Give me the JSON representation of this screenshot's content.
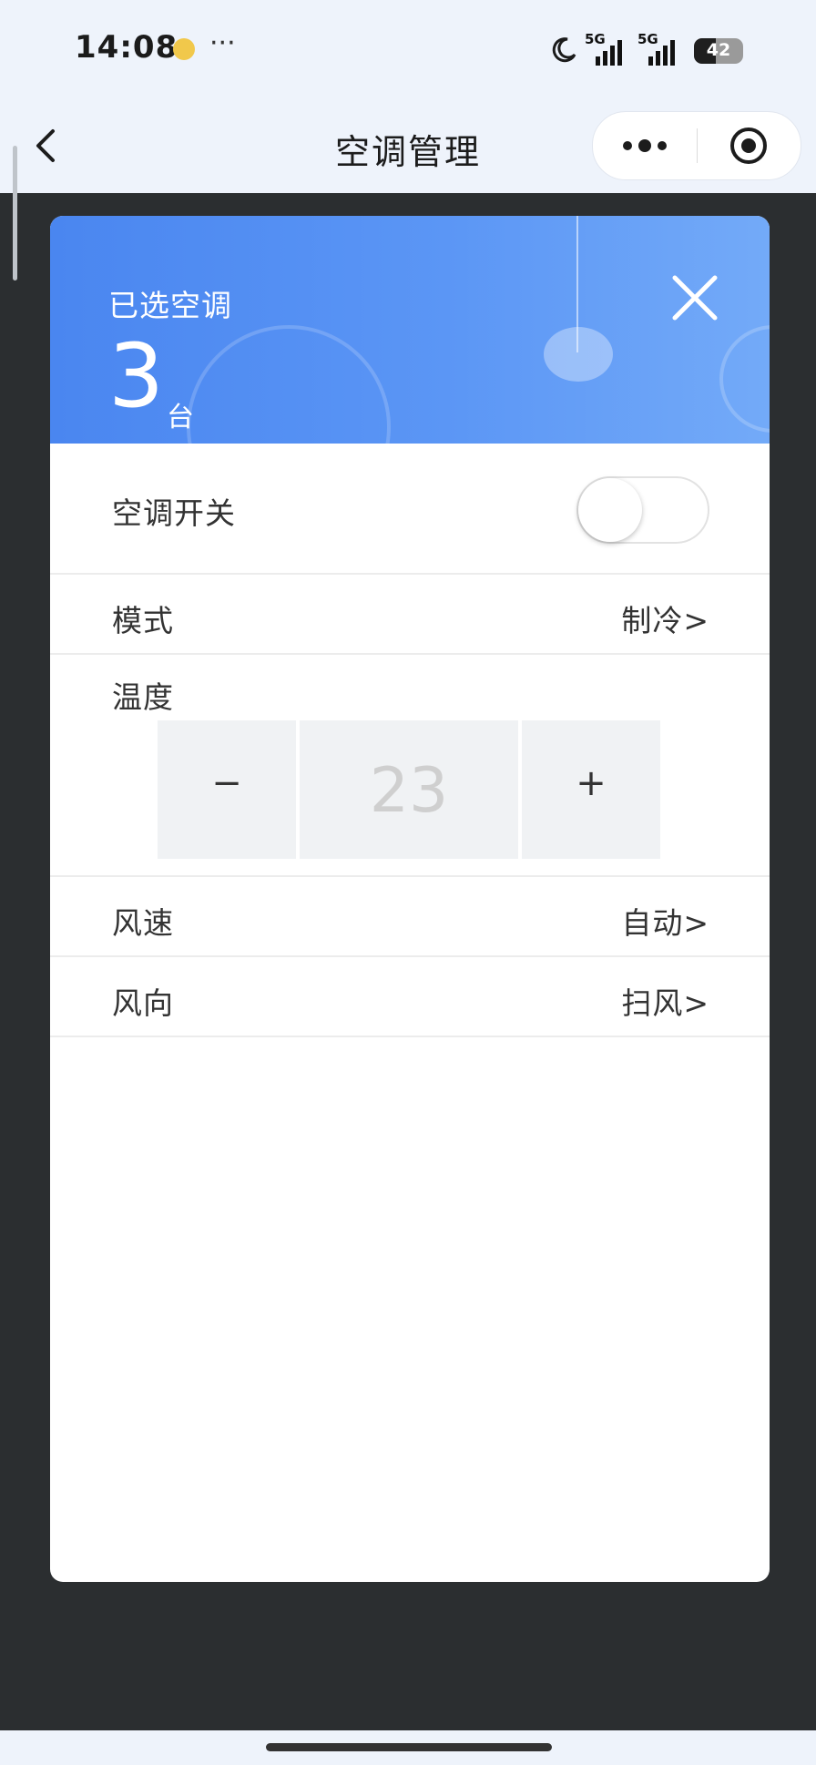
{
  "status_bar": {
    "time": "14:08",
    "more_indicator": "···",
    "signal1_label": "5G",
    "signal2_label": "5G",
    "battery": "42"
  },
  "nav": {
    "title": "空调管理",
    "back_icon": "chevron-left-icon",
    "more_icon": "more-dots-icon",
    "close_icon": "target-circle-icon"
  },
  "panel": {
    "header": {
      "label": "已选空调",
      "count": "3",
      "unit": "台",
      "close_icon": "close-icon"
    },
    "power": {
      "label": "空调开关",
      "on": false
    },
    "mode": {
      "label": "模式",
      "value": "制冷>"
    },
    "temperature": {
      "label": "温度",
      "minus": "−",
      "value": "23",
      "plus": "+"
    },
    "fan_speed": {
      "label": "风速",
      "value": "自动>"
    },
    "fan_direction": {
      "label": "风向",
      "value": "扫风>"
    }
  },
  "colors": {
    "header_blue": "#4a86f0",
    "overlay": "#2b2e30",
    "nav_bg": "#eef3fb"
  }
}
